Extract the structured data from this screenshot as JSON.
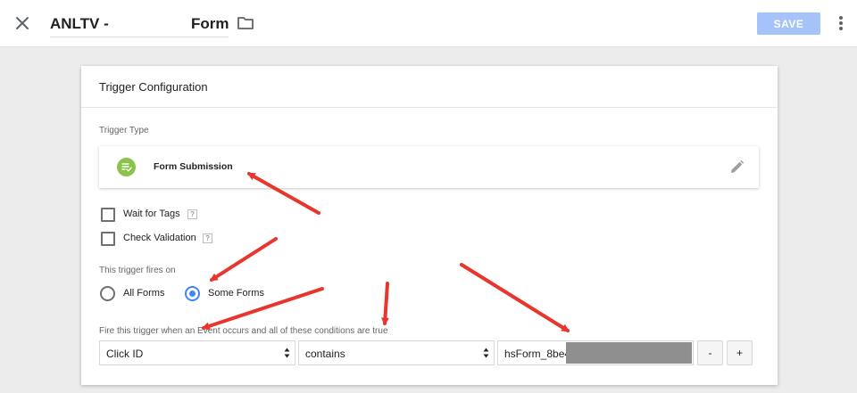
{
  "header": {
    "title_left": "ANLTV -",
    "title_right": "Form",
    "save_label": "SAVE"
  },
  "card": {
    "title": "Trigger Configuration",
    "trigger_type_label": "Trigger Type",
    "trigger_type_value": "Form Submission",
    "options": [
      {
        "label": "Wait for Tags",
        "checked": false,
        "help": "?"
      },
      {
        "label": "Check Validation",
        "checked": false,
        "help": "?"
      }
    ],
    "fires_on_label": "This trigger fires on",
    "fires_on_options": [
      {
        "label": "All Forms",
        "selected": false
      },
      {
        "label": "Some Forms",
        "selected": true
      }
    ],
    "condition_label": "Fire this trigger when an Event occurs and all of these conditions are true",
    "condition": {
      "variable": "Click ID",
      "operator": "contains",
      "value": "hsForm_8be4"
    },
    "remove_label": "-",
    "add_label": "+"
  },
  "colors": {
    "accent": "#4285f4",
    "save_disabled": "#a5c3f8",
    "trigger_icon": "#8bc34a",
    "annotation": "#e8362d",
    "redaction": "#8f8f8f"
  },
  "icons": {
    "close": "close-icon",
    "folder": "folder-icon",
    "more": "more-vert-icon",
    "trigger": "form-submission-icon",
    "edit": "pencil-icon",
    "select": "select-arrows-icon"
  }
}
